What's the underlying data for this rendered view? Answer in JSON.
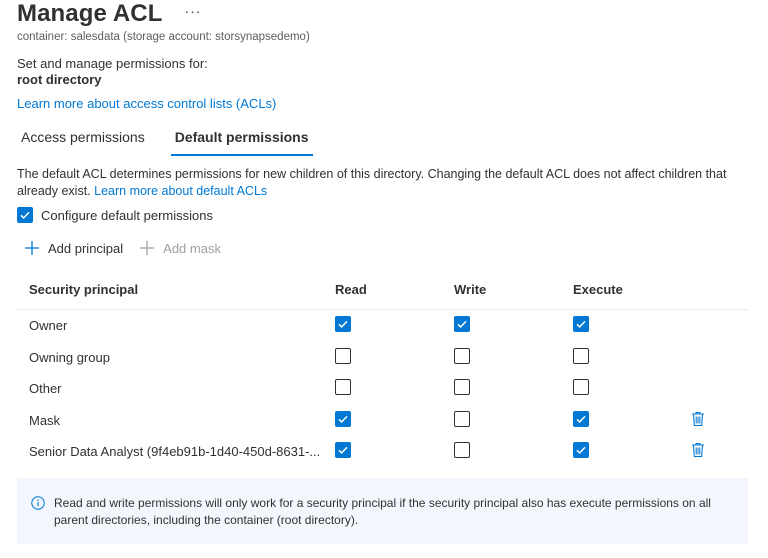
{
  "header": {
    "title": "Manage ACL",
    "more_label": "···",
    "subtitle": "container: salesdata (storage account: storsynapsedemo)"
  },
  "intro": {
    "set_label": "Set and manage permissions for:",
    "target": "root directory",
    "learn_link": "Learn more about access control lists (ACLs)"
  },
  "tabs": [
    {
      "label": "Access permissions",
      "active": false
    },
    {
      "label": "Default permissions",
      "active": true
    }
  ],
  "description": {
    "text": "The default ACL determines permissions for new children of this directory. Changing the default ACL does not affect children that already exist. ",
    "link": "Learn more about default ACLs"
  },
  "config": {
    "label": "Configure default permissions",
    "checked": true
  },
  "toolbar": {
    "add_principal": "Add principal",
    "add_mask": "Add mask"
  },
  "table": {
    "columns": [
      "Security principal",
      "Read",
      "Write",
      "Execute"
    ],
    "rows": [
      {
        "name": "Owner",
        "read": true,
        "write": true,
        "execute": true,
        "deletable": false
      },
      {
        "name": "Owning group",
        "read": false,
        "write": false,
        "execute": false,
        "deletable": false
      },
      {
        "name": "Other",
        "read": false,
        "write": false,
        "execute": false,
        "deletable": false
      },
      {
        "name": "Mask",
        "read": true,
        "write": false,
        "execute": true,
        "deletable": true
      },
      {
        "name": "Senior Data Analyst (9f4eb91b-1d40-450d-8631-...",
        "read": true,
        "write": false,
        "execute": true,
        "deletable": true
      }
    ]
  },
  "info": {
    "text": "Read and write permissions will only work for a security principal if the security principal also has execute permissions on all parent directories, including the container (root directory)."
  },
  "colors": {
    "accent": "#0078d4",
    "text": "#323130",
    "muted": "#605e5c",
    "disabled": "#a19f9d",
    "info_bg": "#f3f6fc"
  },
  "icons": {
    "more": "more-icon",
    "add": "plus-icon",
    "delete": "trash-icon",
    "info": "info-icon",
    "check": "checkmark-icon"
  }
}
